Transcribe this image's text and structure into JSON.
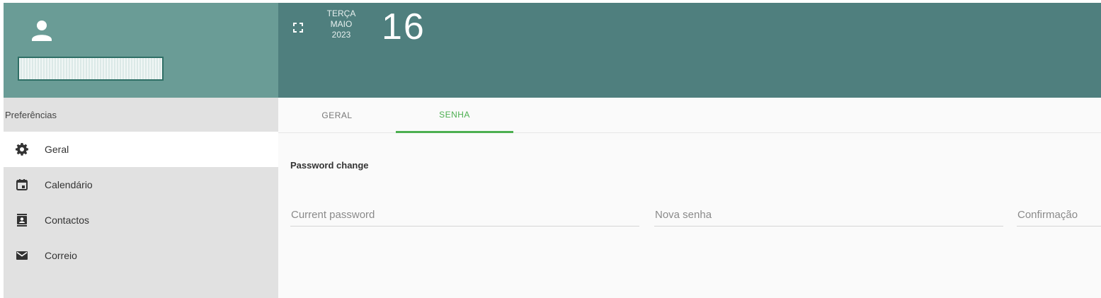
{
  "user": {
    "icon": "user-icon",
    "email_redacted": "[redacted]"
  },
  "header": {
    "fullscreen_icon": "fullscreen-icon",
    "weekday": "TERÇA",
    "month": "MAIO",
    "year": "2023",
    "day": "16"
  },
  "sidebar": {
    "title": "Preferências",
    "items": [
      {
        "label": "Geral",
        "icon": "gear-icon",
        "active": true
      },
      {
        "label": "Calendário",
        "icon": "calendar-icon",
        "active": false
      },
      {
        "label": "Contactos",
        "icon": "contacts-icon",
        "active": false
      },
      {
        "label": "Correio",
        "icon": "mail-icon",
        "active": false
      }
    ]
  },
  "main": {
    "tabs": [
      {
        "label": "GERAL",
        "active": false
      },
      {
        "label": "SENHA",
        "active": true
      }
    ],
    "section_title": "Password change",
    "fields": {
      "current_password": {
        "placeholder": "Current password",
        "value": ""
      },
      "new_password": {
        "placeholder": "Nova senha",
        "value": ""
      },
      "confirmation": {
        "placeholder": "Confirmação",
        "value": ""
      }
    }
  },
  "colors": {
    "user_block_bg": "#6a9c96",
    "header_bg": "#4f7f7e",
    "sidebar_bg": "#e1e1e1",
    "accent": "#4caf50"
  }
}
